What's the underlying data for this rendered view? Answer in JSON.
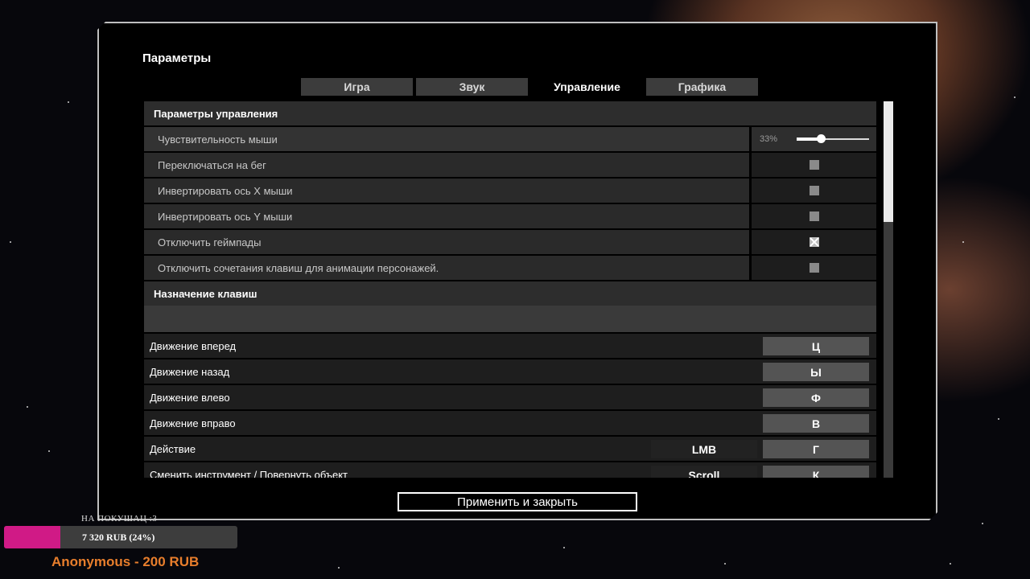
{
  "window": {
    "title": "Параметры"
  },
  "tabs": [
    {
      "label": "Игра",
      "active": false
    },
    {
      "label": "Звук",
      "active": false
    },
    {
      "label": "Управление",
      "active": true
    },
    {
      "label": "Графика",
      "active": false
    }
  ],
  "control_settings": {
    "header": "Параметры управления",
    "mouse_sensitivity": {
      "label": "Чувствительность мыши",
      "value_text": "33%",
      "value": 0.33
    },
    "toggles": [
      {
        "label": "Переключаться на бег",
        "checked": false
      },
      {
        "label": "Инвертировать ось X мыши",
        "checked": false
      },
      {
        "label": "Инвертировать ось Y мыши",
        "checked": false
      },
      {
        "label": "Отключить геймпады",
        "checked": true
      },
      {
        "label": "Отключить сочетания клавиш для анимации персонажей.",
        "checked": false
      }
    ]
  },
  "key_bindings": {
    "header": "Назначение клавиш",
    "rows": [
      {
        "label": "Движение вперед",
        "alt": "",
        "primary": "Ц"
      },
      {
        "label": "Движение назад",
        "alt": "",
        "primary": "Ы"
      },
      {
        "label": "Движение влево",
        "alt": "",
        "primary": "Ф"
      },
      {
        "label": "Движение вправо",
        "alt": "",
        "primary": "В"
      },
      {
        "label": "Действие",
        "alt": "LMB",
        "primary": "Г"
      },
      {
        "label": "Сменить инструмент / Повернуть объект",
        "alt": "Scroll",
        "primary": "К"
      }
    ]
  },
  "scroll": {
    "position": 0.0,
    "visible_fraction": 0.32
  },
  "apply_button": "Применить и закрыть",
  "donation": {
    "goal_label": "НА ПОКУШАЦ :3",
    "progress_text": "7 320 RUB (24%)",
    "progress": 0.24,
    "fill_color": "#d01a86",
    "last_donor": "Anonymous - 200 RUB"
  }
}
